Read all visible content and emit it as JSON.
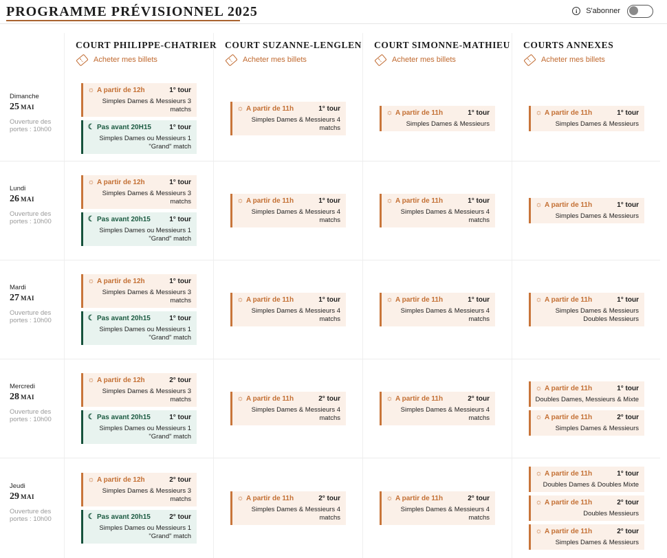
{
  "title": "PROGRAMME PRÉVISIONNEL 2025",
  "subscribe": {
    "info": "i",
    "label": "S'abonner"
  },
  "colors": {
    "accent": "#c8753a",
    "night": "#16523c",
    "day_bg": "#fbf0e8",
    "night_bg": "#e8f3ef"
  },
  "courts": [
    {
      "name": "COURT PHILIPPE-CHATRIER",
      "buy_label": "Acheter mes billets"
    },
    {
      "name": "COURT SUZANNE-LENGLEN",
      "buy_label": "Acheter mes billets"
    },
    {
      "name": "COURT SIMONNE-MATHIEU",
      "buy_label": "Acheter mes billets"
    },
    {
      "name": "COURTS ANNEXES",
      "buy_label": "Acheter mes billets"
    }
  ],
  "days": [
    {
      "name": "Dimanche",
      "date": "25",
      "month": "MAI",
      "doors": "Ouverture des portes : 10h00",
      "cells": [
        [
          {
            "type": "day",
            "icon": "sun-icon",
            "time": "A partir de 12h",
            "round": "1° tour",
            "lines": [
              "Simples Dames & Messieurs 3",
              "matchs"
            ]
          },
          {
            "type": "night",
            "icon": "moon-icon",
            "time": "Pas avant 20H15",
            "round": "1° tour",
            "lines": [
              "Simples Dames ou Messieurs 1",
              "\"Grand\" match"
            ]
          }
        ],
        [
          {
            "type": "day",
            "icon": "sun-icon",
            "time": "A partir de 11h",
            "round": "1° tour",
            "lines": [
              "Simples Dames & Messieurs 4",
              "matchs"
            ]
          }
        ],
        [
          {
            "type": "day",
            "icon": "sun-icon",
            "time": "A partir de 11h",
            "round": "1° tour",
            "lines": [
              "Simples Dames & Messieurs"
            ]
          }
        ],
        [
          {
            "type": "day",
            "icon": "sun-icon",
            "time": "A partir de 11h",
            "round": "1° tour",
            "lines": [
              "Simples Dames & Messieurs"
            ]
          }
        ]
      ]
    },
    {
      "name": "Lundi",
      "date": "26",
      "month": "MAI",
      "doors": "Ouverture des portes : 10h00",
      "cells": [
        [
          {
            "type": "day",
            "icon": "sun-icon",
            "time": "A partir de 12h",
            "round": "1° tour",
            "lines": [
              "Simples Dames & Messieurs 3",
              "matchs"
            ]
          },
          {
            "type": "night",
            "icon": "moon-icon",
            "time": "Pas avant 20h15",
            "round": "1° tour",
            "lines": [
              "Simples Dames ou Messieurs 1",
              "\"Grand\" match"
            ]
          }
        ],
        [
          {
            "type": "day",
            "icon": "sun-icon",
            "time": "A partir de 11h",
            "round": "1° tour",
            "lines": [
              "Simples Dames & Messieurs 4",
              "matchs"
            ]
          }
        ],
        [
          {
            "type": "day",
            "icon": "sun-icon",
            "time": "A partir de 11h",
            "round": "1° tour",
            "lines": [
              "Simples Dames & Messieurs 4",
              "matchs"
            ]
          }
        ],
        [
          {
            "type": "day",
            "icon": "sun-icon",
            "time": "A partir de 11h",
            "round": "1° tour",
            "lines": [
              "Simples Dames & Messieurs"
            ]
          }
        ]
      ]
    },
    {
      "name": "Mardi",
      "date": "27",
      "month": "MAI",
      "doors": "Ouverture des portes : 10h00",
      "cells": [
        [
          {
            "type": "day",
            "icon": "sun-icon",
            "time": "A partir de 12h",
            "round": "1° tour",
            "lines": [
              "Simples Dames & Messieurs 3",
              "matchs"
            ]
          },
          {
            "type": "night",
            "icon": "moon-icon",
            "time": "Pas avant 20h15",
            "round": "1° tour",
            "lines": [
              "Simples Dames ou Messieurs 1",
              "\"Grand\" match"
            ]
          }
        ],
        [
          {
            "type": "day",
            "icon": "sun-icon",
            "time": "A partir de 11h",
            "round": "1° tour",
            "lines": [
              "Simples Dames & Messieurs 4",
              "matchs"
            ]
          }
        ],
        [
          {
            "type": "day",
            "icon": "sun-icon",
            "time": "A partir de 11h",
            "round": "1° tour",
            "lines": [
              "Simples Dames & Messieurs 4",
              "matchs"
            ]
          }
        ],
        [
          {
            "type": "day",
            "icon": "sun-icon",
            "time": "A partir de 11h",
            "round": "1° tour",
            "lines": [
              "Simples Dames & Messieurs",
              "Doubles Messieurs"
            ]
          }
        ]
      ]
    },
    {
      "name": "Mercredi",
      "date": "28",
      "month": "MAI",
      "doors": "Ouverture des portes : 10h00",
      "cells": [
        [
          {
            "type": "day",
            "icon": "sun-icon",
            "time": "A partir de 12h",
            "round": "2° tour",
            "lines": [
              "Simples Dames & Messieurs 3",
              "matchs"
            ]
          },
          {
            "type": "night",
            "icon": "moon-icon",
            "time": "Pas avant 20h15",
            "round": "1° tour",
            "lines": [
              "Simples Dames ou Messieurs 1",
              "\"Grand\" match"
            ]
          }
        ],
        [
          {
            "type": "day",
            "icon": "sun-icon",
            "time": "A partir de 11h",
            "round": "2° tour",
            "lines": [
              "Simples Dames & Messieurs 4",
              "matchs"
            ]
          }
        ],
        [
          {
            "type": "day",
            "icon": "sun-icon",
            "time": "A partir de 11h",
            "round": "2° tour",
            "lines": [
              "Simples Dames & Messieurs 4",
              "matchs"
            ]
          }
        ],
        [
          {
            "type": "day",
            "icon": "sun-icon",
            "time": "A partir de 11h",
            "round": "1° tour",
            "lines": [
              "Doubles Dames, Messieurs & Mixte"
            ]
          },
          {
            "type": "day",
            "icon": "sun-icon",
            "time": "A partir de 11h",
            "round": "2° tour",
            "lines": [
              "Simples Dames & Messieurs"
            ]
          }
        ]
      ]
    },
    {
      "name": "Jeudi",
      "date": "29",
      "month": "MAI",
      "doors": "Ouverture des portes : 10h00",
      "cells": [
        [
          {
            "type": "day",
            "icon": "sun-icon",
            "time": "A partir de 12h",
            "round": "2° tour",
            "lines": [
              "Simples Dames & Messieurs 3",
              "matchs"
            ]
          },
          {
            "type": "night",
            "icon": "moon-icon",
            "time": "Pas avant 20h15",
            "round": "2° tour",
            "lines": [
              "Simples Dames ou Messieurs 1",
              "\"Grand\" match"
            ]
          }
        ],
        [
          {
            "type": "day",
            "icon": "sun-icon",
            "time": "A partir de 11h",
            "round": "2° tour",
            "lines": [
              "Simples Dames & Messieurs 4",
              "matchs"
            ]
          }
        ],
        [
          {
            "type": "day",
            "icon": "sun-icon",
            "time": "A partir de 11h",
            "round": "2° tour",
            "lines": [
              "Simples Dames & Messieurs 4",
              "matchs"
            ]
          }
        ],
        [
          {
            "type": "day",
            "icon": "sun-icon",
            "time": "A partir de 11h",
            "round": "1° tour",
            "lines": [
              "Doubles Dames & Doubles Mixte"
            ]
          },
          {
            "type": "day",
            "icon": "sun-icon",
            "time": "A partir de 11h",
            "round": "2° tour",
            "lines": [
              "Doubles Messieurs"
            ]
          },
          {
            "type": "day",
            "icon": "sun-icon",
            "time": "A partir de 11h",
            "round": "2° tour",
            "lines": [
              "Simples Dames & Messieurs"
            ]
          }
        ]
      ]
    }
  ]
}
